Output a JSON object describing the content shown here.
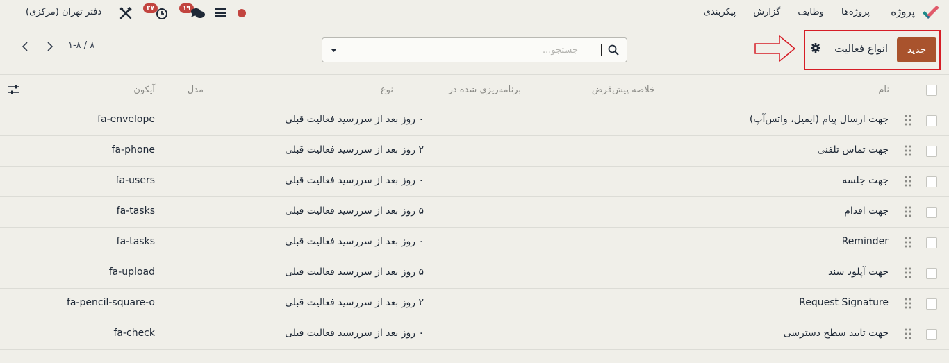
{
  "navbar": {
    "app_name": "پروژه",
    "menu": [
      "پروژه‌ها",
      "وظایف",
      "گزارش",
      "پیکربندی"
    ],
    "company": "دفتر تهران (مرکزی)",
    "activities_count": "۲۷",
    "messages_count": "۱۹",
    "status_color": "#c2443f",
    "icons": [
      "logo-icon",
      "tools-icon",
      "clock-icon",
      "chat-icon",
      "database-icon"
    ]
  },
  "control_panel": {
    "new_label": "جدید",
    "title": "انواع فعالیت",
    "search_placeholder": "جستجو...",
    "pager_text": "۱-۸ / ۸",
    "accent_color": "#a9532d",
    "highlight_color": "#d61d26"
  },
  "table": {
    "headers": {
      "name": "نام",
      "summary": "خلاصه پیش‌فرض",
      "scheduled": "برنامه‌ریزی شده در",
      "type": "نوع",
      "model": "مدل",
      "icon": "آیکون"
    },
    "rows": [
      {
        "name": "جهت ارسال پیام (ایمیل، واتس‌آپ)",
        "scheduled": "۰ روز  بعد از سررسید فعالیت قبلی",
        "icon": "fa-envelope"
      },
      {
        "name": "جهت تماس تلفنی",
        "scheduled": "۲ روز  بعد از سررسید فعالیت قبلی",
        "icon": "fa-phone"
      },
      {
        "name": "جهت جلسه",
        "scheduled": "۰ روز  بعد از سررسید فعالیت قبلی",
        "icon": "fa-users"
      },
      {
        "name": "جهت اقدام",
        "scheduled": "۵ روز  بعد از سررسید فعالیت قبلی",
        "icon": "fa-tasks"
      },
      {
        "name": "Reminder",
        "scheduled": "۰ روز  بعد از سررسید فعالیت قبلی",
        "icon": "fa-tasks"
      },
      {
        "name": "جهت آپلود سند",
        "scheduled": "۵ روز  بعد از سررسید فعالیت قبلی",
        "icon": "fa-upload"
      },
      {
        "name": "Request Signature",
        "scheduled": "۲ روز  بعد از سررسید فعالیت قبلی",
        "icon": "fa-pencil-square-o"
      },
      {
        "name": "جهت تایید سطح دسترسی",
        "scheduled": "۰ روز  بعد از سررسید فعالیت قبلی",
        "icon": "fa-check"
      }
    ]
  }
}
